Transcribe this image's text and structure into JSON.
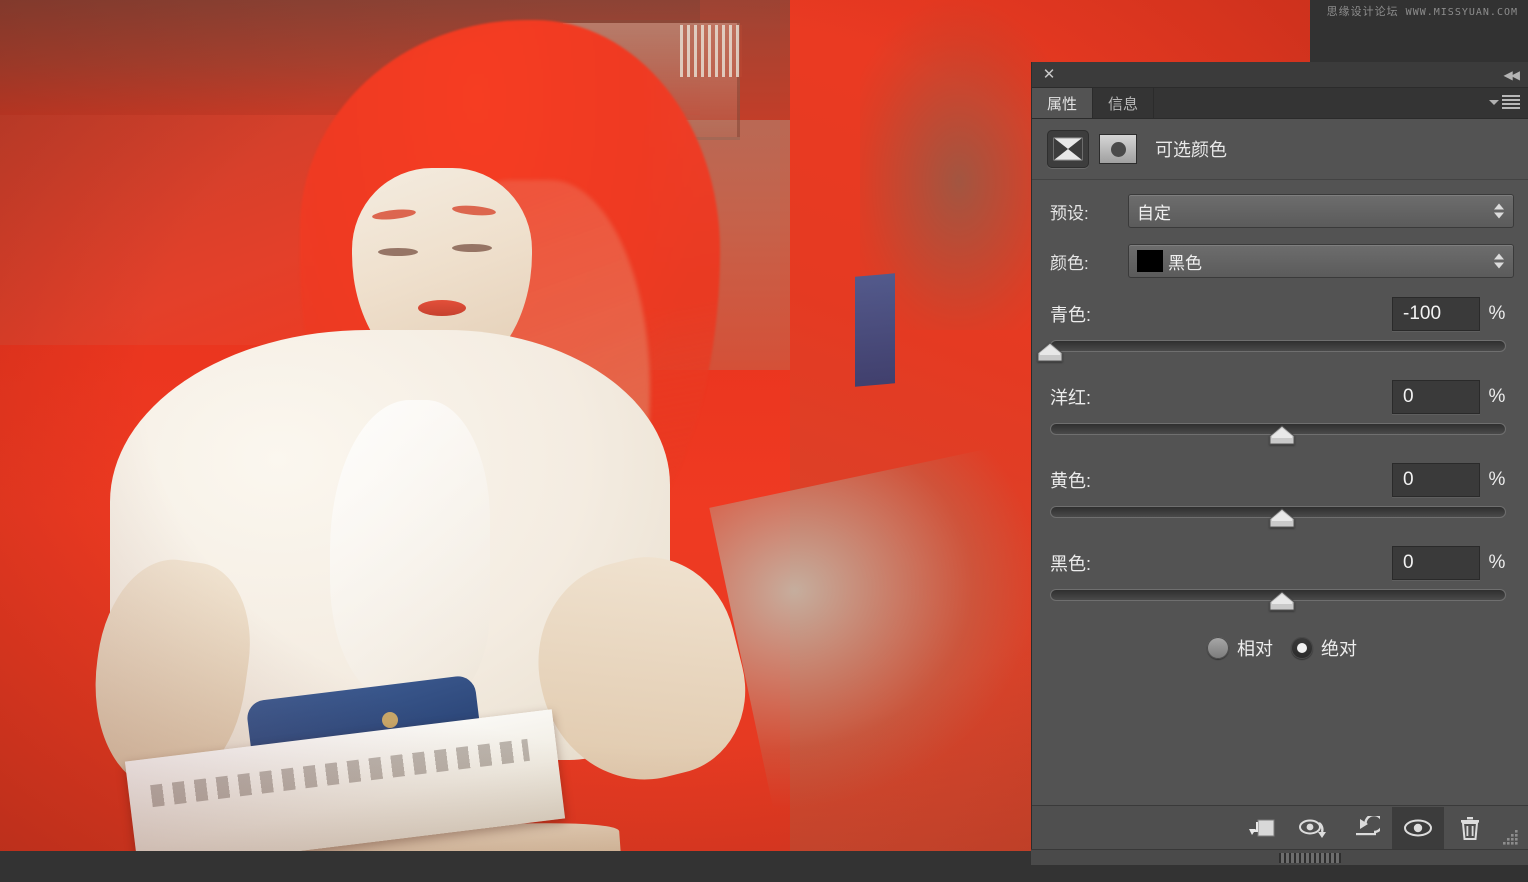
{
  "watermark": {
    "chinese": "思缘设计论坛",
    "url": "WWW.MISSYUAN.COM"
  },
  "panel": {
    "close_label": "✕",
    "collapse_label": "◀◀",
    "tabs": [
      {
        "label": "属性",
        "active": true
      },
      {
        "label": "信息",
        "active": false
      }
    ],
    "adjustment_title": "可选颜色",
    "adjustment_icon": "selective-color-icon",
    "mask_icon": "layer-mask-thumbnail"
  },
  "controls": {
    "preset_label": "预设:",
    "preset_value": "自定",
    "color_label": "颜色:",
    "color_value": "黑色",
    "color_swatch": "#000000"
  },
  "sliders": [
    {
      "label": "青色:",
      "value": "-100",
      "unit": "%",
      "pos_pct": 0,
      "name": "cyan"
    },
    {
      "label": "洋红:",
      "value": "0",
      "unit": "%",
      "pos_pct": 50,
      "name": "magenta"
    },
    {
      "label": "黄色:",
      "value": "0",
      "unit": "%",
      "pos_pct": 50,
      "name": "yellow"
    },
    {
      "label": "黑色:",
      "value": "0",
      "unit": "%",
      "pos_pct": 50,
      "name": "black"
    }
  ],
  "method": {
    "relative_label": "相对",
    "absolute_label": "绝对",
    "selected": "绝对"
  },
  "footer_buttons": [
    {
      "name": "clip-to-layer-icon",
      "active": false
    },
    {
      "name": "view-previous-state-icon",
      "active": false
    },
    {
      "name": "reset-icon",
      "active": false
    },
    {
      "name": "toggle-visibility-icon",
      "active": true
    },
    {
      "name": "delete-icon",
      "active": false
    }
  ],
  "colors": {
    "panel_bg": "#535353",
    "titlebar_bg": "#3b3b3b",
    "field_bg": "#3a3a3a",
    "workspace_bg": "#333333",
    "accent_red": "#ef3a22"
  }
}
